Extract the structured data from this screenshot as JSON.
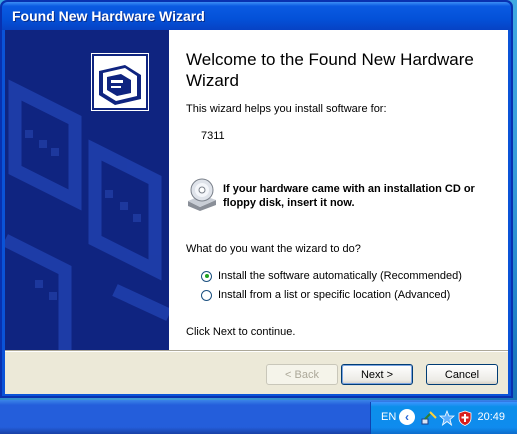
{
  "window": {
    "title": "Found New Hardware Wizard"
  },
  "content": {
    "heading": "Welcome to the Found New Hardware Wizard",
    "intro": "This wizard helps you install software for:",
    "device": "7311",
    "cd_note": "If your hardware came with an installation CD or floppy disk, insert it now.",
    "question": "What do you want the wizard to do?",
    "options": [
      {
        "label": "Install the software automatically (Recommended)",
        "selected": true
      },
      {
        "label": "Install from a list or specific location (Advanced)",
        "selected": false
      }
    ],
    "continue": "Click Next to continue."
  },
  "buttons": {
    "back": "< Back",
    "next": "Next >",
    "cancel": "Cancel"
  },
  "taskbar": {
    "language": "EN",
    "clock": "20:49"
  },
  "icons": [
    "hardware-icon",
    "cd-drive-icon",
    "chevron-left-icon",
    "network-icon",
    "star-icon",
    "shield-icon"
  ],
  "colors": {
    "title_bar": "#0451d8",
    "side_panel": "#0f2480",
    "dialog_bg": "#ece9d8",
    "taskbar": "#245edb",
    "radio_dot": "#21a121"
  }
}
